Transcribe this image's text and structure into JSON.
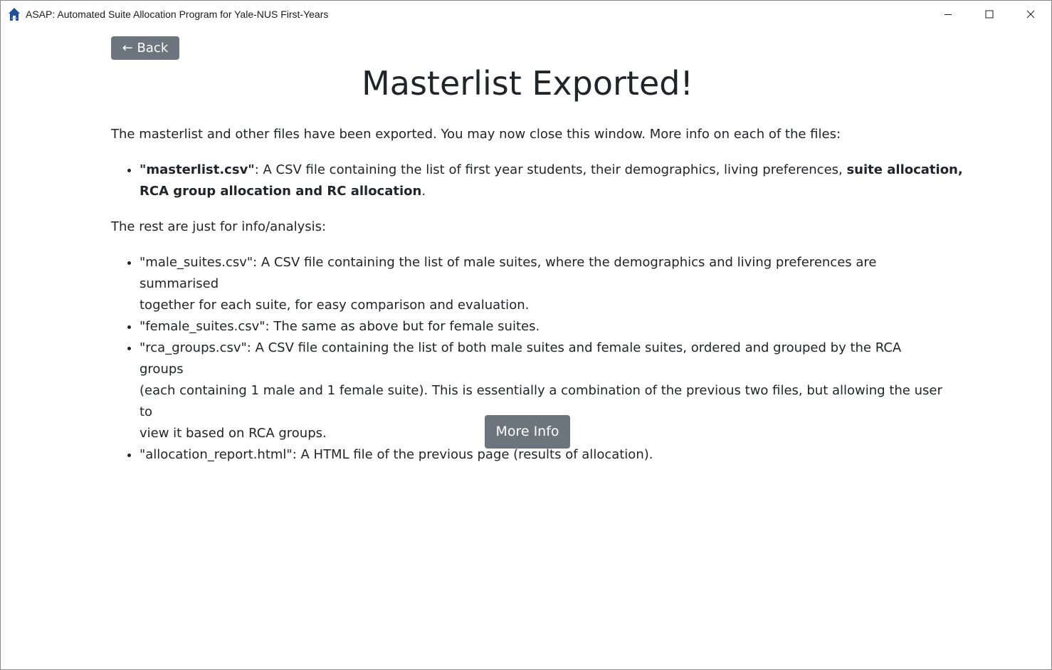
{
  "window": {
    "title": "ASAP: Automated Suite Allocation Program for Yale-NUS First-Years",
    "icon": "house-icon",
    "controls": [
      "minimize-icon",
      "maximize-icon",
      "close-icon"
    ]
  },
  "nav": {
    "back_label": "← Back"
  },
  "page": {
    "title": "Masterlist Exported!",
    "intro": "The masterlist and other files have been exported. You may now close this window. More info on each of the files:",
    "primary_files": [
      {
        "name": "\"masterlist.csv\"",
        "desc_plain": ": A CSV file containing the list of first year students, their demographics, living preferences, ",
        "desc_bold_1": "suite allocation,",
        "desc_bold_2": "RCA group allocation and RC allocation",
        "desc_end": "."
      }
    ],
    "rest_intro": "The rest are just for info/analysis:",
    "other_files": [
      {
        "line1": "\"male_suites.csv\": A CSV file containing the list of male suites, where the demographics and living preferences are summarised",
        "line2": "together for each suite, for easy comparison and evaluation."
      },
      {
        "line1": "\"female_suites.csv\": The same as above but for female suites."
      },
      {
        "line1": "\"rca_groups.csv\": A CSV file containing the list of both male suites and female suites, ordered and grouped by the RCA groups",
        "line2": "(each containing 1 male and 1 female suite). This is essentially a combination of the previous two files, but allowing the user to",
        "line3": "view it based on RCA groups."
      },
      {
        "line1": "\"allocation_report.html\": A HTML file of the previous page (results of allocation)."
      }
    ],
    "more_info_label": "More Info"
  },
  "colors": {
    "button_bg": "#6c757d",
    "button_text": "#ffffff",
    "text": "#212529",
    "icon_blue": "#1f4e9b"
  }
}
